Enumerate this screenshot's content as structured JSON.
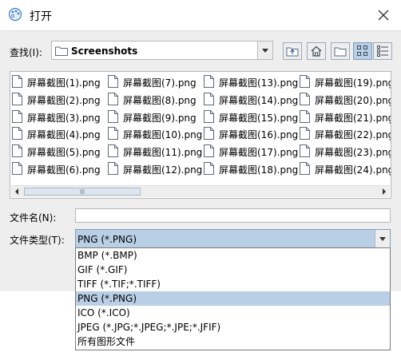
{
  "window": {
    "title": "打开"
  },
  "toolbar": {
    "look_in_label": "查找(I):",
    "look_in_value": "Screenshots",
    "buttons": [
      "up-one-level",
      "home",
      "new-folder",
      "list-view",
      "details-view"
    ]
  },
  "files": {
    "columns": [
      [
        "屏幕截图(1).png",
        "屏幕截图(2).png",
        "屏幕截图(3).png",
        "屏幕截图(4).png",
        "屏幕截图(5).png",
        "屏幕截图(6).png"
      ],
      [
        "屏幕截图(7).png",
        "屏幕截图(8).png",
        "屏幕截图(9).png",
        "屏幕截图(10).png",
        "屏幕截图(11).png",
        "屏幕截图(12).png"
      ],
      [
        "屏幕截图(13).png",
        "屏幕截图(14).png",
        "屏幕截图(15).png",
        "屏幕截图(16).png",
        "屏幕截图(17).png",
        "屏幕截图(18).png"
      ],
      [
        "屏幕截图(19).png",
        "屏幕截图(20).png",
        "屏幕截图(21).png",
        "屏幕截图(22).png",
        "屏幕截图(23).png",
        "屏幕截图(24).png"
      ]
    ]
  },
  "form": {
    "file_name_label": "文件名(N):",
    "file_name_value": "",
    "file_type_label": "文件类型(T):",
    "file_type_value": "PNG (*.PNG)"
  },
  "file_type_options": [
    "BMP (*.BMP)",
    "GIF (*.GIF)",
    "TIFF (*.TIF;*.TIFF)",
    "PNG (*.PNG)",
    "ICO (*.ICO)",
    "JPEG (*.JPG;*.JPEG;*.JPE;*.JFIF)",
    "所有图形文件"
  ],
  "file_type_selected": "PNG (*.PNG)",
  "colors": {
    "selection": "#b8cfe5",
    "dialog_bg": "#eeeeee"
  }
}
